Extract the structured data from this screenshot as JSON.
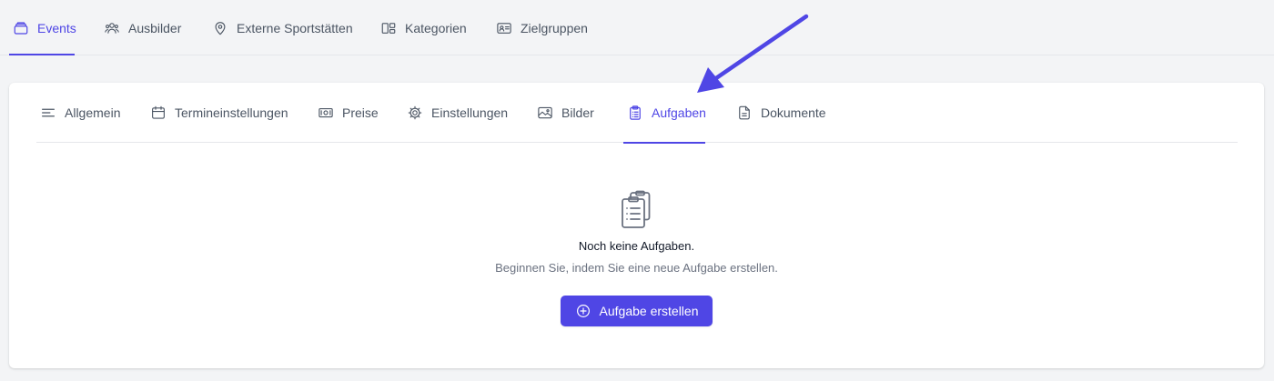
{
  "top_nav": {
    "tabs": [
      {
        "label": "Events",
        "icon": "inbox-stack-icon",
        "active": true
      },
      {
        "label": "Ausbilder",
        "icon": "users-icon",
        "active": false
      },
      {
        "label": "Externe Sportstätten",
        "icon": "map-pin-icon",
        "active": false
      },
      {
        "label": "Kategorien",
        "icon": "categories-icon",
        "active": false
      },
      {
        "label": "Zielgruppen",
        "icon": "id-card-icon",
        "active": false
      }
    ]
  },
  "event_tabs": {
    "tabs": [
      {
        "label": "Allgemein",
        "icon": "menu-lines-icon",
        "active": false
      },
      {
        "label": "Termineinstellungen",
        "icon": "calendar-icon",
        "active": false
      },
      {
        "label": "Preise",
        "icon": "banknote-icon",
        "active": false
      },
      {
        "label": "Einstellungen",
        "icon": "cog-icon",
        "active": false
      },
      {
        "label": "Bilder",
        "icon": "image-icon",
        "active": false
      },
      {
        "label": "Aufgaben",
        "icon": "clipboard-list-icon",
        "active": true
      },
      {
        "label": "Dokumente",
        "icon": "document-icon",
        "active": false
      }
    ]
  },
  "empty_state": {
    "icon": "clipboard-list-icon",
    "title": "Noch keine Aufgaben.",
    "subtitle": "Beginnen Sie, indem Sie eine neue Aufgabe erstellen.",
    "button_label": "Aufgabe erstellen",
    "button_icon": "plus-circle-icon"
  },
  "colors": {
    "accent": "#4f46e5",
    "page_background": "#f3f4f6",
    "card_background": "#ffffff",
    "annotation_arrow": "#4f46e5"
  }
}
